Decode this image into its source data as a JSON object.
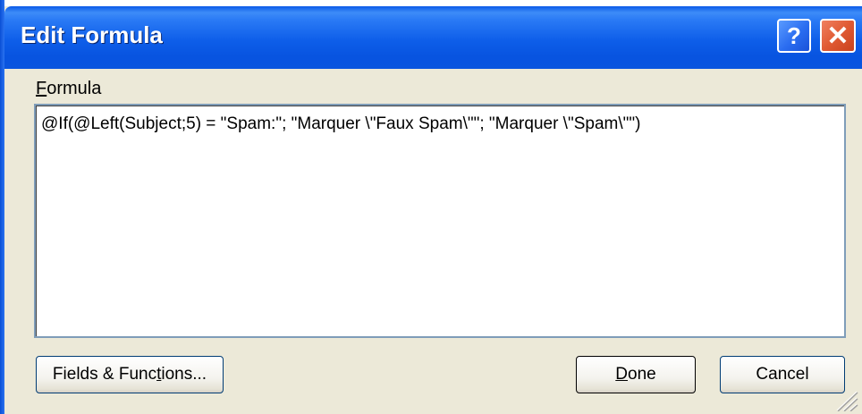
{
  "window": {
    "title": "Edit Formula",
    "help_label": "?",
    "close_label": "✕"
  },
  "formula": {
    "label": "Formula",
    "label_mnemonic_rest": "ormula",
    "label_mnemonic_first": "F",
    "value": "@If(@Left(Subject;5) = \"Spam:\"; \"Marquer \\\"Faux Spam\\\"\"; \"Marquer \\\"Spam\\\"\")"
  },
  "buttons": {
    "fields_functions_pre": "Fields & Func",
    "fields_functions_mnemonic": "t",
    "fields_functions_post": "ions...",
    "done_mnemonic": "D",
    "done_rest": "one",
    "cancel": "Cancel"
  },
  "colors": {
    "titlebar": "#0a55df",
    "dialog_bg": "#ece9d8",
    "close_button": "#e05a33"
  },
  "icons": {
    "help": "question-mark",
    "close": "x-mark",
    "resize": "size-grip"
  }
}
